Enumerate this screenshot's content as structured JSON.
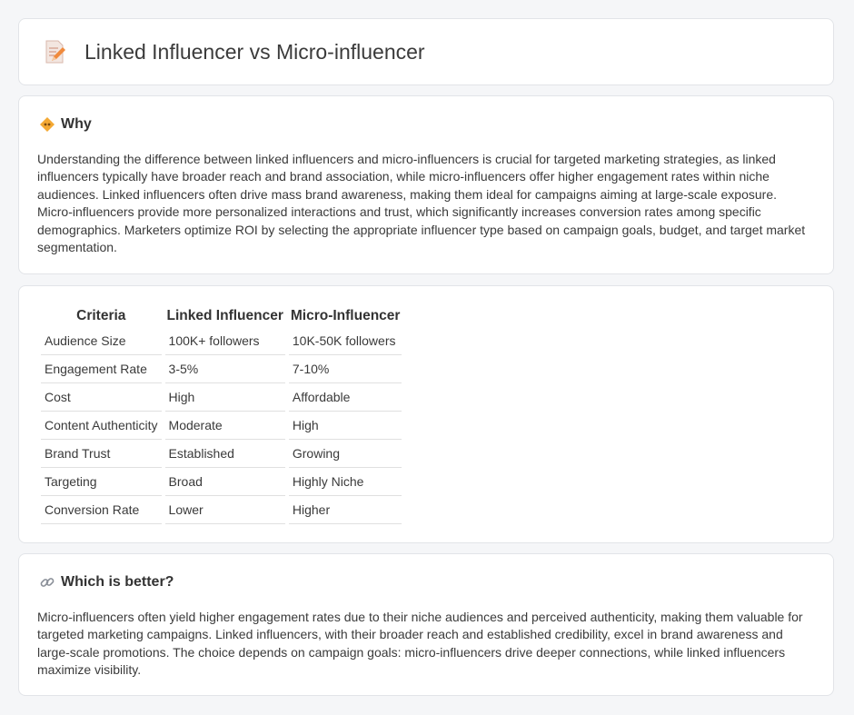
{
  "header": {
    "title": "Linked Influencer vs Micro-influencer",
    "icon": "document-pencil-icon"
  },
  "why": {
    "icon": "diamond-icon",
    "title": "Why",
    "text": "Understanding the difference between linked influencers and micro-influencers is crucial for targeted marketing strategies, as linked influencers typically have broader reach and brand association, while micro-influencers offer higher engagement rates within niche audiences. Linked influencers often drive mass brand awareness, making them ideal for campaigns aiming at large-scale exposure. Micro-influencers provide more personalized interactions and trust, which significantly increases conversion rates among specific demographics. Marketers optimize ROI by selecting the appropriate influencer type based on campaign goals, budget, and target market segmentation."
  },
  "table": {
    "headers": [
      "Criteria",
      "Linked Influencer",
      "Micro-Influencer"
    ],
    "rows": [
      [
        "Audience Size",
        "100K+ followers",
        "10K-50K followers"
      ],
      [
        "Engagement Rate",
        "3-5%",
        "7-10%"
      ],
      [
        "Cost",
        "High",
        "Affordable"
      ],
      [
        "Content Authenticity",
        "Moderate",
        "High"
      ],
      [
        "Brand Trust",
        "Established",
        "Growing"
      ],
      [
        "Targeting",
        "Broad",
        "Highly Niche"
      ],
      [
        "Conversion Rate",
        "Lower",
        "Higher"
      ]
    ]
  },
  "better": {
    "icon": "link-icon",
    "title": "Which is better?",
    "text": "Micro-influencers often yield higher engagement rates due to their niche audiences and perceived authenticity, making them valuable for targeted marketing campaigns. Linked influencers, with their broader reach and established credibility, excel in brand awareness and large-scale promotions. The choice depends on campaign goals: micro-influencers drive deeper connections, while linked influencers maximize visibility."
  }
}
